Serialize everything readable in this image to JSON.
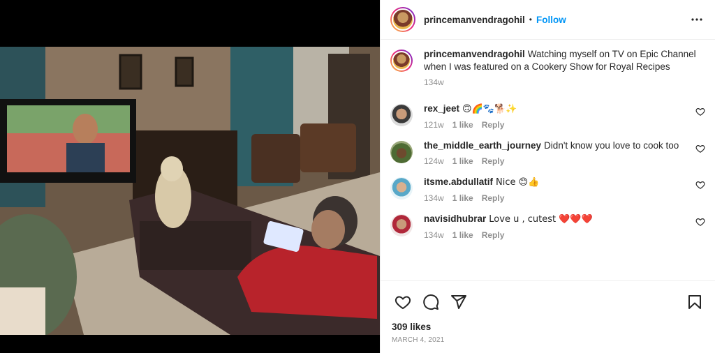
{
  "post": {
    "username": "princemanvendragohil",
    "follow_label": "Follow",
    "separator": "•"
  },
  "caption": {
    "username": "princemanvendragohil",
    "text": "Watching myself on TV on Epic Channel when I was featured on a Cookery Show for Royal Recipes",
    "time": "134w"
  },
  "comments": [
    {
      "username": "rex_jeet",
      "text": "🙃🌈🐾🐕✨",
      "time": "121w",
      "likes": "1 like",
      "reply": "Reply"
    },
    {
      "username": "the_middle_earth_journey",
      "text": "Didn't know you love to cook too",
      "time": "124w",
      "likes": "1 like",
      "reply": "Reply"
    },
    {
      "username": "itsme.abdullatif",
      "text": "Nice 😊👍",
      "time": "134w",
      "likes": "1 like",
      "reply": "Reply"
    },
    {
      "username": "navisidhubrar",
      "text": "Love u , cutest ❤️❤️❤️",
      "time": "134w",
      "likes": "1 like",
      "reply": "Reply"
    }
  ],
  "footer": {
    "likes": "309 likes",
    "date": "March 4, 2021"
  },
  "colors": {
    "link": "#0095f6",
    "text": "#262626",
    "muted": "#8e8e8e",
    "heart_red": "#ed4956"
  },
  "icons": [
    "more-icon",
    "heart-icon",
    "comment-icon",
    "share-icon",
    "bookmark-icon"
  ]
}
